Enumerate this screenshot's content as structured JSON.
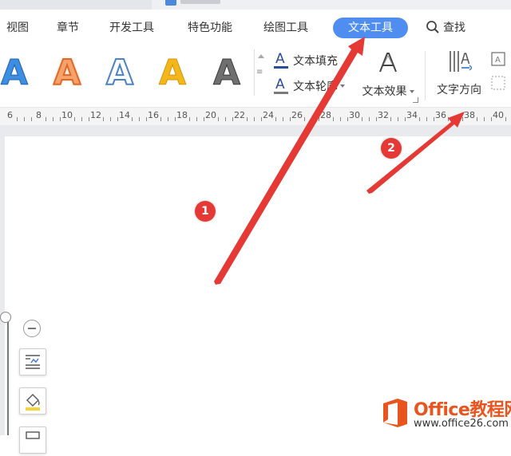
{
  "menubar": {
    "items": [
      "视图",
      "章节",
      "开发工具",
      "特色功能",
      "绘图工具"
    ],
    "active": "文本工具",
    "search": "查找",
    "active_color": "#4f8ef0"
  },
  "ribbon": {
    "gallery_styles": [
      {
        "glyph": "A",
        "style": "blue-outline"
      },
      {
        "glyph": "A",
        "style": "orange-glow"
      },
      {
        "glyph": "A",
        "style": "outline"
      },
      {
        "glyph": "A",
        "style": "gold"
      },
      {
        "glyph": "A",
        "style": "gray-gradient"
      }
    ],
    "text_fill": "文本填充",
    "text_outline": "文本轮廓",
    "text_effect": "文本效果",
    "text_direction": "文字方向"
  },
  "ruler": {
    "labels": [
      "6",
      "8",
      "10",
      "12",
      "14",
      "16",
      "18",
      "20",
      "22",
      "24",
      "26",
      "28",
      "30",
      "32",
      "34",
      "36",
      "38",
      "40"
    ]
  },
  "annotations": {
    "callout_1": "1",
    "callout_2": "2",
    "color": "#e53935"
  },
  "watermark": {
    "line1": "Office教程网",
    "line2": "www.office26.com"
  }
}
